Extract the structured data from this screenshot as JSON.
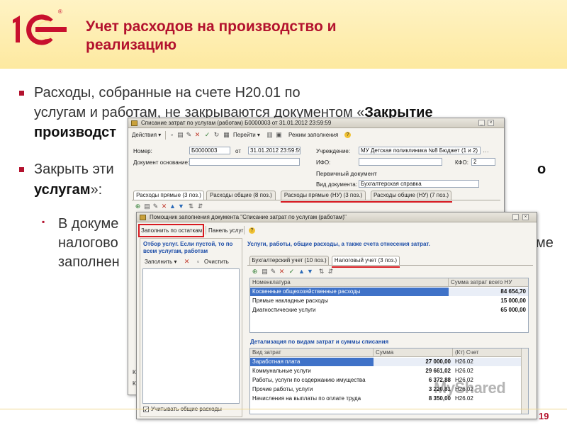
{
  "header": {
    "title_line1": "Учет расходов на производство и",
    "title_line2": "реализацию",
    "logo_reg": "®"
  },
  "slide": {
    "b1_l1": "Расходы, собранные на счете Н20.01 по",
    "b1_l2a": "услугам и работам, не закрываются документом «",
    "b1_l2b": "Закрытие",
    "b1_l3": "производст",
    "b2_l1": "Закрыть эти",
    "b2_l1r": "о",
    "b2_l2a": "услугам",
    "b2_l2b": "»:",
    "b3_l1": "В докуме",
    "b3_l2": "налогово",
    "b3_l2r": "ме",
    "b3_l3": "заполнен",
    "page_number": "19"
  },
  "main_window": {
    "title": "Списание затрат по услугам (работам) Б0000003 от 31.01.2012 23:59:59",
    "toolbar": {
      "actions": "Действия",
      "goto": "Перейти",
      "fill_mode": "Режим заполнения"
    },
    "number_label": "Номер:",
    "number_value": "Б0000003",
    "date_label": "от",
    "date_value": "31.01.2012 23:59:59",
    "base_doc_label": "Документ основание:",
    "org_label": "Учреждение:",
    "org_value": "МУ Детская поликлиника №8 Бюджет (1 и 2)",
    "ifo_label": "ИФО:",
    "kfo_label": "КФО:",
    "kfo_value": "2",
    "primary_doc": "Первичный документ",
    "doc_type_label": "Вид документа:",
    "doc_type_value": "Бухгалтерская справка",
    "tabs": [
      "Расходы прямые (3 поз.)",
      "Расходы общие (8 поз.)",
      "Расходы прямые (НУ) (3 поз.)",
      "Расходы общие (НУ) (7 поз.)"
    ],
    "left_letters": [
      "К",
      "К"
    ]
  },
  "helper_window": {
    "title": "Помощник заполнения документа \"Списание затрат по услугам (работам)\"",
    "fill_by_balances": "Заполнить по остаткам",
    "services_panel": "Панель услуг",
    "left_heading": "Отбор услуг. Если пустой, то по всем услугам, работам",
    "fill_btn": "Заполнить",
    "clear_btn": "Очистить",
    "use_common_checkbox": "Учитывать общие расходы",
    "right_heading": "Услуги, работы, общие расходы, а также счета отнесения затрат.",
    "tabs": [
      "Бухгалтерский учет (10 поз.)",
      "Налоговый учет (3 поз.)"
    ],
    "grid1": {
      "col1": "Номенклатура",
      "col2": "Сумма затрат всего НУ",
      "rows": [
        {
          "name": "Косвенные общехозяйственные расходы",
          "sum": "84 654,70"
        },
        {
          "name": "Прямые накладные расходы",
          "sum": "15 000,00"
        },
        {
          "name": "Диагностические услуги",
          "sum": "65 000,00"
        }
      ]
    },
    "detail_heading": "Детализация по видам затрат и суммы списания",
    "grid2": {
      "col1": "Вид затрат",
      "col2": "Сумма",
      "col3": "(Кт) Счет",
      "rows": [
        {
          "name": "Заработная плата",
          "sum": "27 000,00",
          "acct": "Н26.02"
        },
        {
          "name": "Коммунальные услуги",
          "sum": "29 661,02",
          "acct": "Н26.02"
        },
        {
          "name": "Работы, услуги по содержанию имущества",
          "sum": "6 372,88",
          "acct": "Н26.02"
        },
        {
          "name": "Прочие работы, услуги",
          "sum": "3 220,81",
          "acct": "Н26.02"
        },
        {
          "name": "Начисления на выплаты по оплате труда",
          "sum": "8 350,00",
          "acct": "Н26.02"
        }
      ]
    }
  },
  "watermark": "MyShared",
  "colors": {
    "accent": "#b3122e",
    "highlight": "#d71920",
    "selection": "#3f72c8"
  }
}
